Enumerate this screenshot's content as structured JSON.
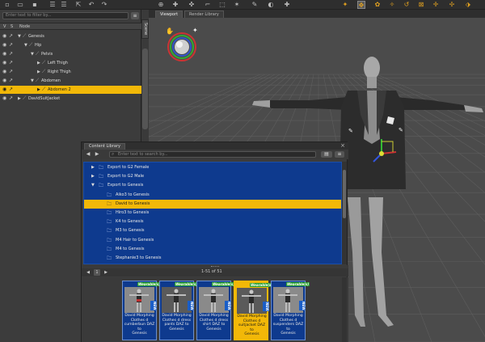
{
  "scene": {
    "search_placeholder": "Enter text to filter by...",
    "menu_icon": "menu-icon",
    "columns": {
      "visible": "V",
      "selectable": "S",
      "node": "Node"
    },
    "nodes": [
      {
        "label": "Genesis",
        "depth": 0,
        "expanded": true,
        "selected": false
      },
      {
        "label": "Hip",
        "depth": 1,
        "expanded": true,
        "selected": false
      },
      {
        "label": "Pelvis",
        "depth": 2,
        "expanded": true,
        "selected": false
      },
      {
        "label": "Left Thigh",
        "depth": 3,
        "expanded": false,
        "selected": false
      },
      {
        "label": "Right Thigh",
        "depth": 3,
        "expanded": false,
        "selected": false
      },
      {
        "label": "Abdomen",
        "depth": 2,
        "expanded": true,
        "selected": false
      },
      {
        "label": "Abdomen 2",
        "depth": 3,
        "expanded": false,
        "selected": true
      },
      {
        "label": "DavidSuitJacket",
        "depth": 0,
        "expanded": false,
        "selected": false
      }
    ]
  },
  "side_tab": {
    "label": "Scene"
  },
  "viewport": {
    "tabs": [
      {
        "label": "Viewport",
        "active": true
      },
      {
        "label": "Render Library",
        "active": false
      }
    ]
  },
  "library": {
    "title": "Content Library",
    "search_placeholder": "Enter text to search by...",
    "folders": [
      {
        "label": "Export to G2 Female",
        "depth": 1,
        "arrow": "collapsed",
        "selected": false
      },
      {
        "label": "Export to G2 Male",
        "depth": 1,
        "arrow": "collapsed",
        "selected": false
      },
      {
        "label": "Export to Genesis",
        "depth": 1,
        "arrow": "expanded",
        "selected": false
      },
      {
        "label": "Aiko3 to Genesis",
        "depth": 2,
        "arrow": "none",
        "selected": false
      },
      {
        "label": "David to Genesis",
        "depth": 2,
        "arrow": "none",
        "selected": true
      },
      {
        "label": "Hiro3 to Genesis",
        "depth": 2,
        "arrow": "none",
        "selected": false
      },
      {
        "label": "K4 to Genesis",
        "depth": 2,
        "arrow": "none",
        "selected": false
      },
      {
        "label": "M3 to Genesis",
        "depth": 2,
        "arrow": "none",
        "selected": false
      },
      {
        "label": "M4 Hair to Genesis",
        "depth": 2,
        "arrow": "none",
        "selected": false
      },
      {
        "label": "M4 to Genesis",
        "depth": 2,
        "arrow": "none",
        "selected": false
      },
      {
        "label": "Stephanie3 to Genesis",
        "depth": 2,
        "arrow": "none",
        "selected": false
      }
    ],
    "pager": {
      "info": "1-51 of 51",
      "page": "1"
    },
    "items": [
      {
        "badge": "Wearable(s)",
        "new": "NEW",
        "caption": "David Morphing\nClothes d\ncumberbun DAZ to\nGenesis",
        "selected": false
      },
      {
        "badge": "Wearable(s)",
        "new": "NEW",
        "caption": "David Morphing\nClothes d dress\npants DAZ to\nGenesis",
        "selected": false
      },
      {
        "badge": "Wearable(s)",
        "new": "NEW",
        "caption": "David Morphing\nClothes d dress\nshirt DAZ to\nGenesis",
        "selected": false
      },
      {
        "badge": "Wearable(s)",
        "new": "NEW",
        "caption": "David Morphing\nClothes d\nsuitjacket DAZ to\nGenesis",
        "selected": true
      },
      {
        "badge": "Wearable(s)",
        "new": "NEW",
        "caption": "David Morphing\nClothes d\nsuspenders DAZ to\nGenesis",
        "selected": false
      }
    ]
  },
  "colors": {
    "selection": "#f2b808",
    "library_bg": "#0e3a8e",
    "badge": "#28a030",
    "new_badge": "#1a5ec8"
  }
}
